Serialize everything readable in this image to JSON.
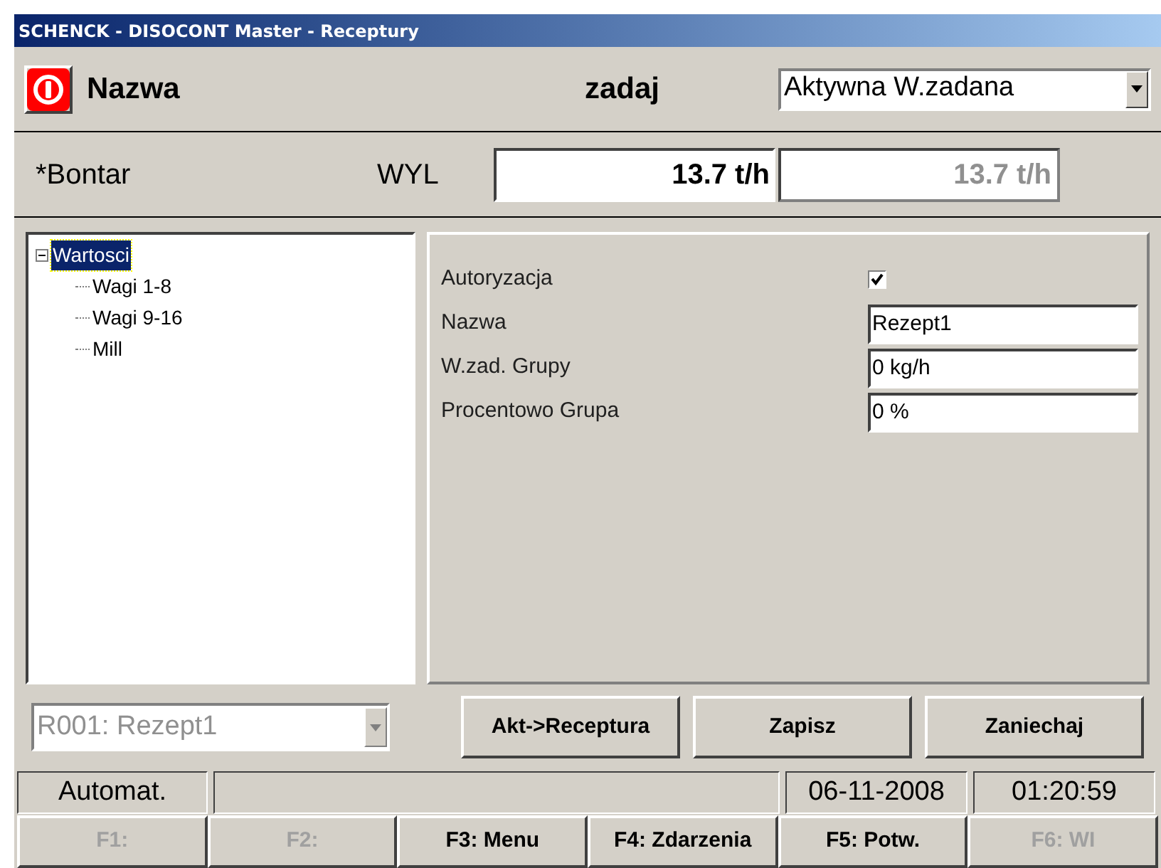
{
  "window": {
    "title": "SCHENCK - DISOCONT Master - Receptury"
  },
  "header": {
    "name_label": "Nazwa",
    "setpoint_label": "zadaj",
    "mode_dropdown": {
      "value": "Aktywna W.zadana"
    }
  },
  "feeder": {
    "name": "*Bontar",
    "mode": "WYL",
    "setpoint": "13.7 t/h",
    "actual": "13.7 t/h"
  },
  "tree": [
    {
      "label": "Wartosci",
      "selected": true,
      "expanded": true,
      "children": [
        {
          "label": "Wagi 1-8",
          "selected": false
        },
        {
          "label": "Wagi 9-16",
          "selected": false
        },
        {
          "label": "Mill",
          "selected": false
        }
      ]
    }
  ],
  "properties": [
    {
      "kind": "checkbox",
      "label": "Autoryzacja",
      "checked": true
    },
    {
      "kind": "field",
      "label": "Nazwa",
      "value": "Rezept1"
    },
    {
      "kind": "field",
      "label": "W.zad. Grupy",
      "value": "0 kg/h"
    },
    {
      "kind": "field",
      "label": "Procentowo Grupa",
      "value": "0 %"
    }
  ],
  "recipe_dropdown": {
    "value": "R001: Rezept1",
    "disabled": true
  },
  "buttons": [
    "Akt->Receptura",
    "Zapisz",
    "Zaniechaj"
  ],
  "status_bar": {
    "mode": "Automat.",
    "date": "06-11-2008",
    "time": "01:20:59"
  },
  "function_keys": [
    {
      "label": "F1:",
      "disabled": true
    },
    {
      "label": "F2:",
      "disabled": true
    },
    {
      "label": "F3: Menu",
      "disabled": false
    },
    {
      "label": "F4: Zdarzenia",
      "disabled": false
    },
    {
      "label": "F5: Potw.",
      "disabled": false
    },
    {
      "label": "F6: WI",
      "disabled": true
    }
  ]
}
